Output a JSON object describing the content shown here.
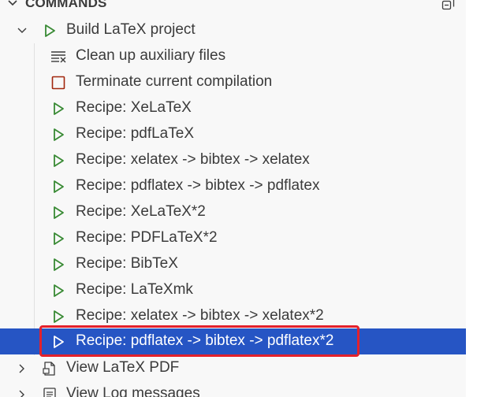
{
  "section": {
    "title": "COMMANDS",
    "collapse_icon": "collapse-all-icon"
  },
  "tree": {
    "build": {
      "label": "Build LaTeX project",
      "icon": "play-icon",
      "expanded": true
    },
    "children": [
      {
        "label": "Clean up auxiliary files",
        "icon": "clear-all-icon"
      },
      {
        "label": "Terminate current compilation",
        "icon": "stop-icon"
      },
      {
        "label": "Recipe: XeLaTeX",
        "icon": "play-icon"
      },
      {
        "label": "Recipe: pdfLaTeX",
        "icon": "play-icon"
      },
      {
        "label": "Recipe: xelatex -> bibtex -> xelatex",
        "icon": "play-icon"
      },
      {
        "label": "Recipe: pdflatex -> bibtex -> pdflatex",
        "icon": "play-icon"
      },
      {
        "label": "Recipe: XeLaTeX*2",
        "icon": "play-icon"
      },
      {
        "label": "Recipe: PDFLaTeX*2",
        "icon": "play-icon"
      },
      {
        "label": "Recipe: BibTeX",
        "icon": "play-icon"
      },
      {
        "label": "Recipe: LaTeXmk",
        "icon": "play-icon"
      },
      {
        "label": "Recipe: xelatex -> bibtex -> xelatex*2",
        "icon": "play-icon"
      },
      {
        "label": "Recipe: pdflatex -> bibtex -> pdflatex*2",
        "icon": "play-icon",
        "selected": true
      }
    ],
    "view_pdf": {
      "label": "View LaTeX PDF",
      "icon": "pdf-file-icon",
      "expanded": false
    },
    "view_log": {
      "label": "View Log messages",
      "icon": "log-file-icon",
      "expanded": false
    }
  },
  "colors": {
    "play_green": "#388a34",
    "stop_red": "#a1260d",
    "selection_blue": "#2655c4",
    "highlight_red": "#e3212b"
  }
}
